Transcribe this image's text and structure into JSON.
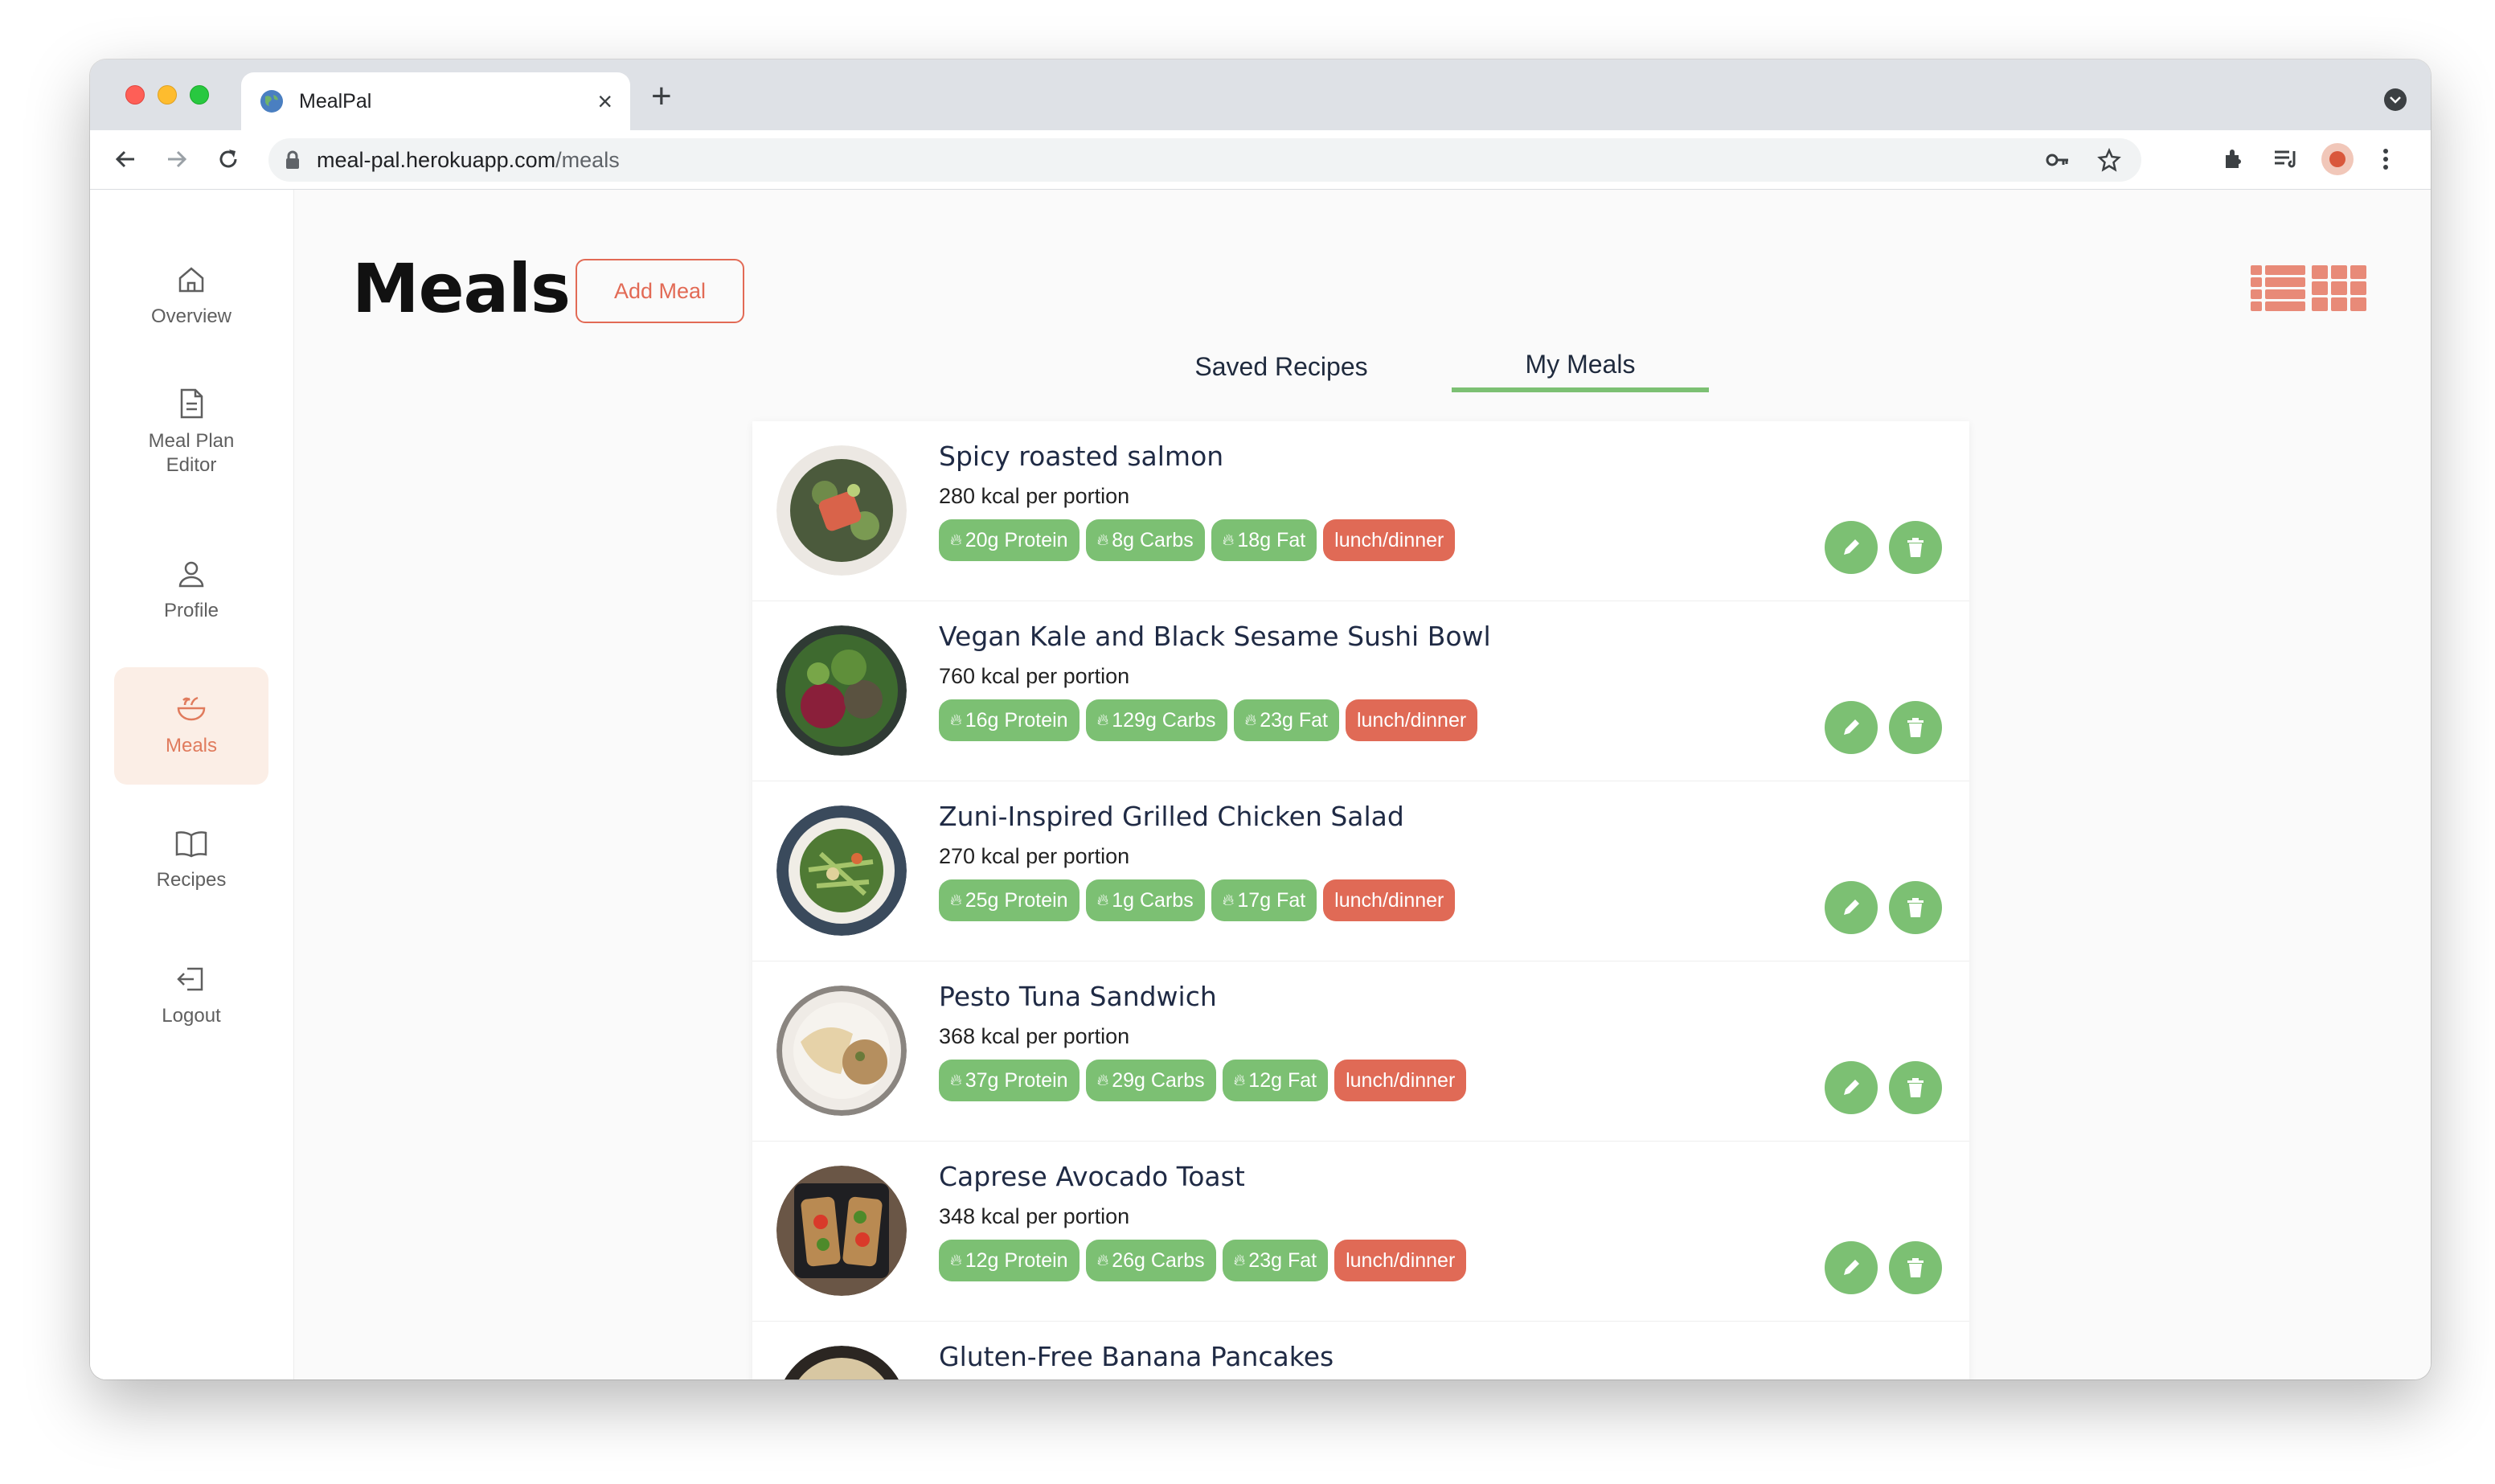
{
  "browser": {
    "tab_title": "MealPal",
    "url_host": "meal-pal.herokuapp.com",
    "url_path": "/meals"
  },
  "sidebar": {
    "items": [
      {
        "label": "Overview",
        "icon": "home-icon"
      },
      {
        "label": "Meal Plan Editor",
        "icon": "document-icon"
      },
      {
        "label": "Profile",
        "icon": "user-icon"
      },
      {
        "label": "Meals",
        "icon": "bowl-icon",
        "active": true
      },
      {
        "label": "Recipes",
        "icon": "book-icon"
      },
      {
        "label": "Logout",
        "icon": "logout-icon"
      }
    ]
  },
  "header": {
    "title": "Meals",
    "add_button": "Add Meal"
  },
  "tabs": [
    {
      "label": "Saved Recipes",
      "active": false
    },
    {
      "label": "My Meals",
      "active": true
    }
  ],
  "meals": [
    {
      "name": "Spicy roasted salmon",
      "kcal": "280 kcal per portion",
      "protein": "20g Protein",
      "carbs": "8g Carbs",
      "fat": "18g Fat",
      "type": "lunch/dinner"
    },
    {
      "name": "Vegan Kale and Black Sesame Sushi Bowl",
      "kcal": "760 kcal per portion",
      "protein": "16g Protein",
      "carbs": "129g Carbs",
      "fat": "23g Fat",
      "type": "lunch/dinner"
    },
    {
      "name": "Zuni-Inspired Grilled Chicken Salad",
      "kcal": "270 kcal per portion",
      "protein": "25g Protein",
      "carbs": "1g Carbs",
      "fat": "17g Fat",
      "type": "lunch/dinner"
    },
    {
      "name": "Pesto Tuna Sandwich",
      "kcal": "368 kcal per portion",
      "protein": "37g Protein",
      "carbs": "29g Carbs",
      "fat": "12g Fat",
      "type": "lunch/dinner"
    },
    {
      "name": "Caprese Avocado Toast",
      "kcal": "348 kcal per portion",
      "protein": "12g Protein",
      "carbs": "26g Carbs",
      "fat": "23g Fat",
      "type": "lunch/dinner"
    },
    {
      "name": "Gluten-Free Banana Pancakes"
    }
  ],
  "colors": {
    "accent": "#e26a55",
    "green": "#7cc073",
    "active_bg": "#fbeee6"
  }
}
